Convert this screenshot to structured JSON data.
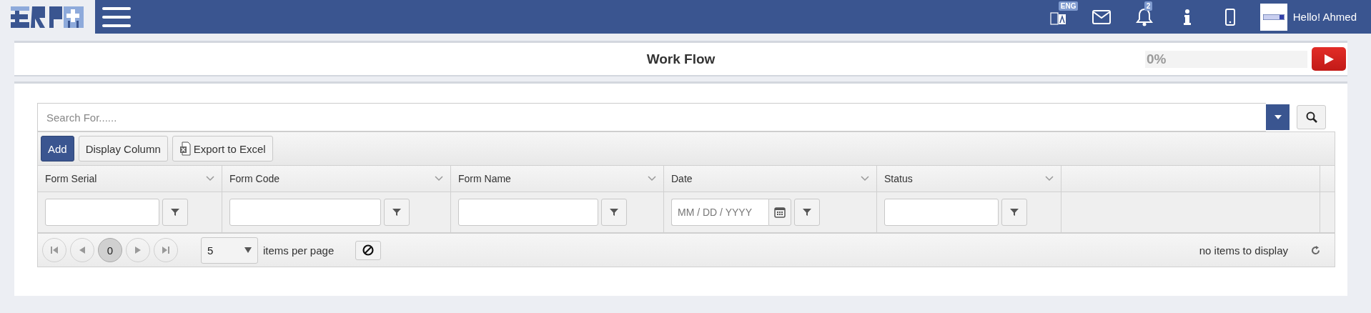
{
  "header": {
    "language": "ENG",
    "notification_count": "2",
    "greeting": "Hello! Ahmed"
  },
  "page": {
    "title": "Work Flow",
    "progress": {
      "level": 0,
      "reading": "0%"
    }
  },
  "search": {
    "placeholder": "Search For......"
  },
  "toolbar": [
    {
      "label": "Add",
      "kind": "primary"
    },
    {
      "label": "Display Column",
      "kind": "plain"
    },
    {
      "label": "Export to Excel",
      "kind": "excel"
    }
  ],
  "columns": [
    {
      "title": "Form Serial",
      "kind": "text"
    },
    {
      "title": "Form Code",
      "kind": "text"
    },
    {
      "title": "Form Name",
      "kind": "text"
    },
    {
      "title": "Date",
      "kind": "date",
      "placeholder": "MM / DD / YYYY"
    },
    {
      "title": "Status",
      "kind": "text"
    }
  ],
  "pager": {
    "page": "0",
    "page_size": "5",
    "page_size_label": "items per page",
    "status": "no items to display"
  }
}
